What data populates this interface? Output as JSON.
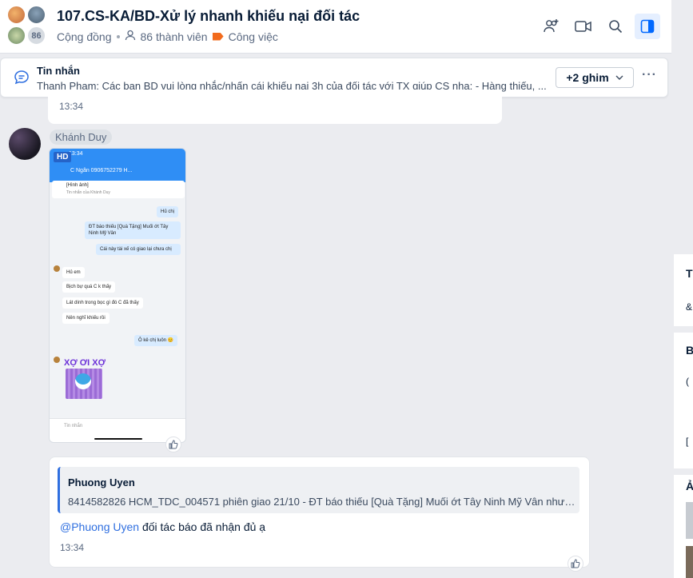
{
  "header": {
    "title": "107.CS-KA/BD-Xử lý nhanh khiếu nại đối tác",
    "avatar_count": "86",
    "community_label": "Cộng đồng",
    "members_label": "86 thành viên",
    "tag_label": "Công việc"
  },
  "pinned": {
    "title": "Tin nhắn",
    "text": "Thanh Phạm: Các bạn BD vui lòng nhắc/nhấn cái khiếu nại 3h của đối tác với TX giúp CS nha: - Hàng thiếu, ...",
    "more_pins_label": "+2 ghim"
  },
  "previous_message": {
    "time": "13:34"
  },
  "image_message": {
    "sender": "Khánh Duy",
    "badge": "HD",
    "screenshot": {
      "status_time": "13:34",
      "chat_title": "C Ngân 0906752279 H...",
      "pin_title": "[Hình ảnh]",
      "pin_sub": "Tin nhắn của Khánh Duy",
      "bubbles": [
        "Hủ chị",
        "ĐT báo thiếu [Quà Tặng] Muối ớt Tây Ninh Mỹ Vân",
        "Cái này tài xế có giao lại chưa chị",
        "Hủ em",
        "Bịch bự quá C k thấy",
        "Lát dính trong bọc gì đó C đã thấy",
        "Nên nghĩ khiếu rồi",
        "Ô kê chị luôn 😊"
      ],
      "sticker_text": "XỢ ƠI XỢ",
      "input_placeholder": "Tin nhắn"
    }
  },
  "reply_message": {
    "quote_author": "Phuong Uyen",
    "quote_text": "8414582826 HCM_TDC_004571 phiên giao 21/10 - ĐT báo thiếu [Quà Tặng] Muối ớt Tây Ninh Mỹ Vân nhưng...",
    "mention": "@Phuong Uyen",
    "text": " đối tác báo đã nhận đủ ạ",
    "time": "13:34"
  },
  "right_panel": {
    "letters": [
      "T",
      "B",
      "Ả"
    ]
  },
  "colors": {
    "accent": "#2f6fe0",
    "tag": "#f26b1d",
    "background": "#ebecf0"
  }
}
